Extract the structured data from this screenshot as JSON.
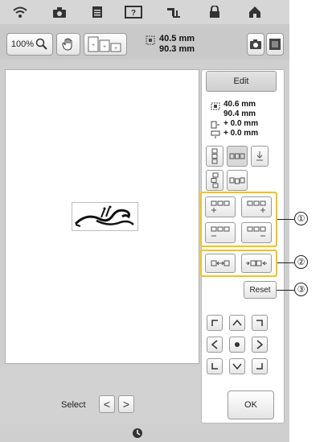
{
  "toolbar": {
    "zoom_label": "100%",
    "size_width": "40.5 mm",
    "size_height": "90.3 mm"
  },
  "top_icons": [
    "wifi-icon",
    "camera-icon",
    "document-icon",
    "help-icon",
    "sewing-machine-icon",
    "lock-icon",
    "home-icon"
  ],
  "right_panel": {
    "edit_label": "Edit",
    "info": {
      "width": "40.6 mm",
      "height": "90.4 mm",
      "offset_x": "+ 0.0 mm",
      "offset_y": "+ 0.0 mm"
    },
    "reset_label": "Reset",
    "ok_label": "OK"
  },
  "bottom": {
    "select_label": "Select",
    "prev_glyph": "<",
    "next_glyph": ">"
  },
  "callouts": [
    "①",
    "②",
    "③"
  ],
  "colors": {
    "highlight": "#f2c21b",
    "background": "#cfcfcf",
    "panel": "#ffffff"
  }
}
